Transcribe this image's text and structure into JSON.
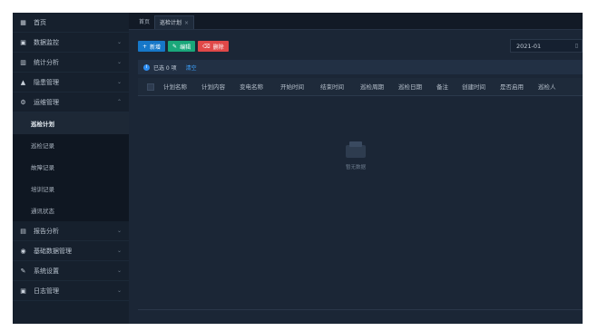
{
  "sidebar": {
    "items": [
      {
        "label": "首页",
        "icon": "home-icon",
        "glyph": "▦"
      },
      {
        "label": "数据监控",
        "icon": "monitor-icon",
        "glyph": "▣"
      },
      {
        "label": "统计分析",
        "icon": "bar-chart-icon",
        "glyph": "▥"
      },
      {
        "label": "隐患管理",
        "icon": "warning-icon",
        "glyph": "▲"
      },
      {
        "label": "运维管理",
        "icon": "settings-icon",
        "glyph": "⚙"
      }
    ],
    "sub_items": [
      "巡检计划",
      "巡检记录",
      "故障记录",
      "培训记录",
      "通讯状态"
    ],
    "bottom_items": [
      {
        "label": "报告分析",
        "icon": "report-icon",
        "glyph": "▤"
      },
      {
        "label": "基础数据管理",
        "icon": "database-icon",
        "glyph": "◉"
      },
      {
        "label": "系统设置",
        "icon": "wrench-icon",
        "glyph": "✎"
      },
      {
        "label": "日志管理",
        "icon": "log-icon",
        "glyph": "▣"
      }
    ]
  },
  "tabs": {
    "home": "首页",
    "current": "巡检计划",
    "close": "×"
  },
  "toolbar": {
    "add_label": "新增",
    "add_glyph": "+",
    "edit_label": "编辑",
    "edit_glyph": "✎",
    "delete_label": "删除",
    "delete_glyph": "🗑"
  },
  "date_picker": {
    "value": "2021-01",
    "icon": "calendar-icon",
    "glyph": "▯"
  },
  "selection": {
    "icon": "info-icon",
    "glyph": "i",
    "selected_text": "已选 0 项",
    "clear_label": "清空"
  },
  "table": {
    "columns": [
      "计划名称",
      "计划内容",
      "变电名称",
      "开始时间",
      "结束时间",
      "巡检周期",
      "巡检日期",
      "备注",
      "创建时间",
      "是否启用",
      "巡检人"
    ],
    "empty_text": "暂无数据"
  },
  "colors": {
    "sidebar_bg": "#16202d",
    "main_bg": "#1b2636",
    "add": "#1677c8",
    "edit": "#1aa77a",
    "delete": "#e04848",
    "link": "#3ea3ff"
  }
}
